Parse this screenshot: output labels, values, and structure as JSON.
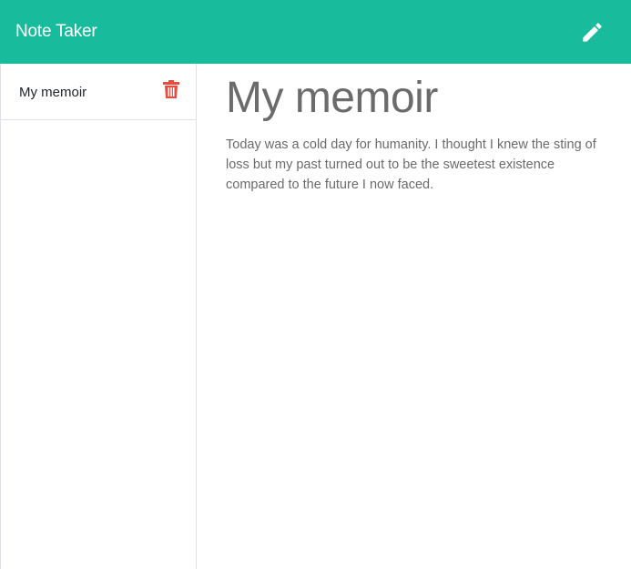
{
  "navbar": {
    "brand": "Note Taker",
    "new_note_icon": "pencil-icon",
    "background": "#18bc9c"
  },
  "sidebar": {
    "notes": [
      {
        "title": "My memoir",
        "delete_icon": "trash-icon"
      }
    ]
  },
  "main": {
    "note_title": "My memoir",
    "note_text": "Today was a cold day for humanity. I thought I knew the sting of loss but my past turned out to be the sweetest existence compared to the future I now faced."
  },
  "colors": {
    "delete": "#e74c3c",
    "text": "#6b6b6b"
  }
}
